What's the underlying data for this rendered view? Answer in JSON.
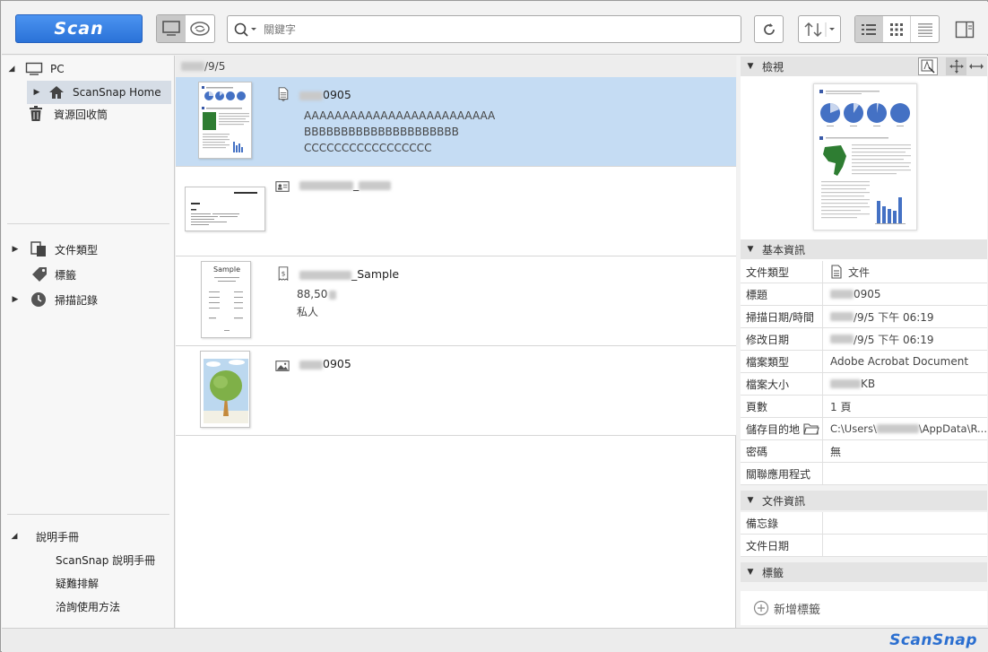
{
  "toolbar": {
    "scan_label": "Scan",
    "search_placeholder": "關鍵字"
  },
  "nav": {
    "pc_label": "PC",
    "scansnap_home_label": "ScanSnap Home",
    "trash_label": "資源回收筒",
    "doc_type_label": "文件類型",
    "tags_label": "標籤",
    "scan_history_label": "掃描記錄",
    "help_label": "說明手冊",
    "help_items": [
      "ScanSnap 說明手冊",
      "疑難排解",
      "洽詢使用方法"
    ]
  },
  "list": {
    "date_header_suffix": "/9/5",
    "items": [
      {
        "title_suffix": "0905",
        "lines": [
          "AAAAAAAAAAAAAAAAAAAAAAAAA",
          "BBBBBBBBBBBBBBBBBBBBB",
          "CCCCCCCCCCCCCCCCC"
        ]
      },
      {
        "title_suffix": "_",
        "lines": []
      },
      {
        "title_suffix": "_Sample",
        "lines": [
          "88,50",
          "私人"
        ]
      },
      {
        "title_suffix": "0905",
        "lines": []
      }
    ],
    "thumb_receipt_title": "Sample"
  },
  "right": {
    "preview_header": "檢視",
    "basic_header": "基本資訊",
    "basic_rows": [
      {
        "key": "文件類型",
        "value": "文件"
      },
      {
        "key": "標題",
        "value": "0905"
      },
      {
        "key": "掃描日期/時間",
        "value": "/9/5 下午 06:19"
      },
      {
        "key": "修改日期",
        "value": "/9/5 下午 06:19"
      },
      {
        "key": "檔案類型",
        "value": "Adobe Acrobat Document"
      },
      {
        "key": "檔案大小",
        "value": "KB"
      },
      {
        "key": "頁數",
        "value": "1 頁"
      },
      {
        "key": "儲存目的地",
        "value_prefix": "C:\\Users\\",
        "value_suffix": "\\AppData\\R..."
      },
      {
        "key": "密碼",
        "value": "無"
      },
      {
        "key": "關聯應用程式",
        "value": ""
      }
    ],
    "doc_info_header": "文件資訊",
    "doc_info_rows": [
      {
        "key": "備忘錄",
        "value": ""
      },
      {
        "key": "文件日期",
        "value": ""
      }
    ],
    "tags_header": "標籤",
    "add_tag_label": "新增標籤"
  },
  "footer": {
    "logo": "ScanSnap"
  },
  "colors": {
    "accent": "#2a72d8",
    "selection": "#c5dcf3",
    "nav_selection": "#d6dde6"
  }
}
